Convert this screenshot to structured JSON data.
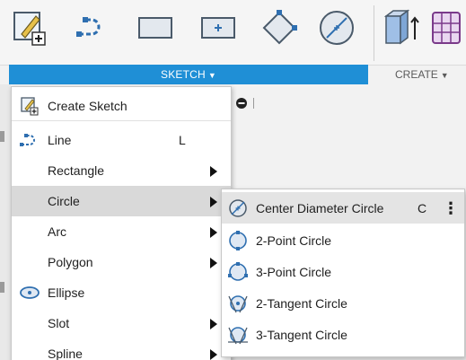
{
  "toolbar": {
    "icons": [
      "create-sketch-icon",
      "line-icon",
      "rectangle-icon",
      "center-rectangle-icon",
      "polygon-icon",
      "circle-icon",
      "extrude-icon",
      "create-more-icon"
    ]
  },
  "tabs": {
    "sketch": "SKETCH",
    "create": "CREATE"
  },
  "sketch_menu": {
    "items": [
      {
        "label": "Create Sketch",
        "shortcut": "",
        "submenu": false
      },
      {
        "label": "Line",
        "shortcut": "L",
        "submenu": false
      },
      {
        "label": "Rectangle",
        "shortcut": "",
        "submenu": true
      },
      {
        "label": "Circle",
        "shortcut": "",
        "submenu": true,
        "active": true
      },
      {
        "label": "Arc",
        "shortcut": "",
        "submenu": true
      },
      {
        "label": "Polygon",
        "shortcut": "",
        "submenu": true
      },
      {
        "label": "Ellipse",
        "shortcut": "",
        "submenu": false
      },
      {
        "label": "Slot",
        "shortcut": "",
        "submenu": true
      },
      {
        "label": "Spline",
        "shortcut": "",
        "submenu": true
      }
    ]
  },
  "circle_submenu": {
    "items": [
      {
        "label": "Center Diameter Circle",
        "shortcut": "C",
        "more": "⋮"
      },
      {
        "label": "2-Point Circle",
        "shortcut": ""
      },
      {
        "label": "3-Point Circle",
        "shortcut": ""
      },
      {
        "label": "2-Tangent Circle",
        "shortcut": ""
      },
      {
        "label": "3-Tangent Circle",
        "shortcut": ""
      }
    ]
  },
  "colors": {
    "accent": "#1f8fd6",
    "icon_blue": "#2f6fb0",
    "menu_active": "#d9d9d9"
  }
}
